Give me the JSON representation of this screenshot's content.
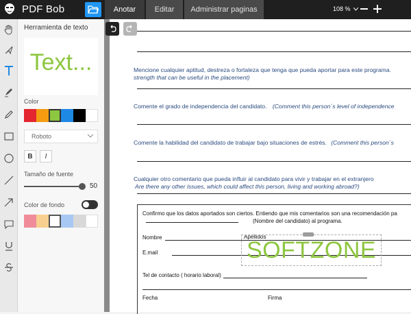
{
  "app": {
    "name": "PDF Bob"
  },
  "tabs": [
    {
      "label": "Anotar",
      "active": true
    },
    {
      "label": "Editar",
      "active": false
    },
    {
      "label": "Administrar paginas",
      "active": false
    }
  ],
  "zoom": {
    "value": "108 %",
    "icon": "chevron-down-icon"
  },
  "tools": [
    "hand-icon",
    "select-arrow-icon",
    "text-icon",
    "highlighter-icon",
    "pencil-icon",
    "rectangle-icon",
    "circle-icon",
    "line-icon",
    "arrow-icon",
    "comment-icon",
    "underline-icon",
    "strikethrough-icon"
  ],
  "panel": {
    "title": "Herramienta de texto",
    "preview_text": "Text...",
    "color_label": "Color",
    "colors": [
      "#e3262f",
      "#f39c12",
      "#8dc63f",
      "#1e88e5",
      "#000000",
      "#ffffff"
    ],
    "selected_color": "#8dc63f",
    "font_value": "Roboto",
    "bold_label": "B",
    "italic_label": "I",
    "font_size_label": "Tamaño de fuente",
    "font_size_value": "50",
    "font_size_level": 50,
    "bg_label": "Color de fondo",
    "bg_enabled": false,
    "bg_colors": [
      "#f08c9a",
      "#f7cf8e",
      "#ffffff",
      "#a7c8f2",
      "#d8d8d8",
      "#ffffff"
    ]
  },
  "document": {
    "q1_es": "Mencione cualquier aptitud, destreza o fortaleza que tenga que pueda aportar para este programa.",
    "q1_en": "strength that can be useful in the placement)",
    "q2_es": "Comente el grado de independencia del candidato.",
    "q2_en": "(Comment this person´s level of independence",
    "q3_es": "Comente la habilidad del candidato de trabajar bajo situaciones de estrés.",
    "q3_en": "(Comment this person´s",
    "q4_es": "Cualquier otro comentario que pueda influir al candidato para vivir y trabajar en el extranjero",
    "q4_en": "Are there any other issues, which could affect this person, living and working abroad?)",
    "confirm_1": "Confirmo que los datos aportados son ciertos. Entiendo que mis comentarios son una recomendación pa",
    "confirm_2": "(Nombre del candidato) al programa.",
    "nombre": "Nombre",
    "apellidos": "Apellidos",
    "email": "E.mail",
    "telefono": "Tel de contacto ( horario laboral)",
    "fecha": "Fecha",
    "firma": "Firma",
    "watermark_text": "SOFTZONE"
  }
}
